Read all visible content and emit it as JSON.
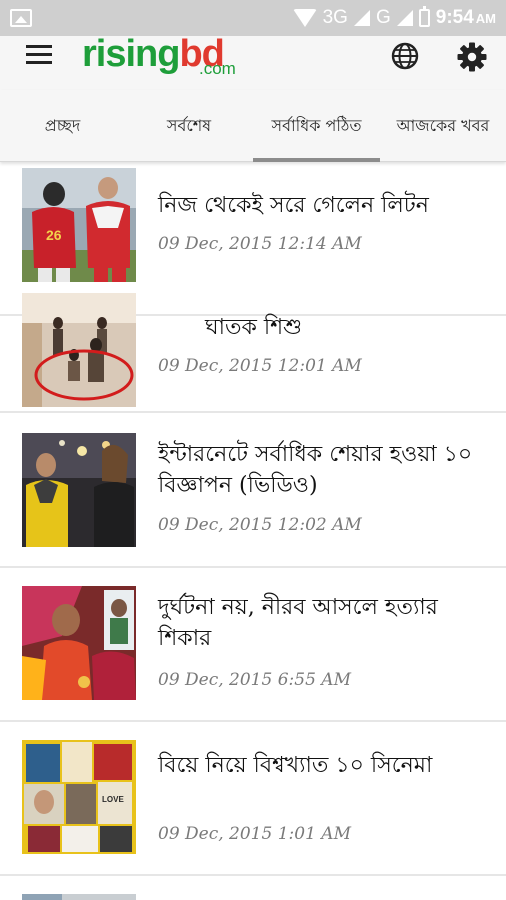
{
  "status_bar": {
    "network_3g": "3G",
    "network_g": "G",
    "time": "9:54",
    "ampm": "AM"
  },
  "app_bar": {
    "logo_text_main": "rising",
    "logo_text_bd": "bd",
    "logo_text_com": ".com",
    "brand_green": "#1e9e3a",
    "brand_red": "#e03a2f"
  },
  "tabs": [
    {
      "label": "প্রচ্ছদ"
    },
    {
      "label": "সর্বশেষ"
    },
    {
      "label": "সর্বাধিক পঠিত",
      "selected": true
    },
    {
      "label": "আজকের খবর"
    }
  ],
  "articles": [
    {
      "title": "নিজ থেকেই সরে গেলেন লিটন",
      "date": "09 Dec, 2015 12:14 AM",
      "thumb": "cricket-players"
    },
    {
      "title": "ঘাতক শিশু",
      "date": "09 Dec, 2015 12:01 AM",
      "thumb": "cctv-child-circled"
    },
    {
      "title": "ইন্টারনেটে সর্বাধিক শেয়ার হওয়া ১০ বিজ্ঞাপন (ভিডিও)",
      "date": "09 Dec, 2015 12:02 AM",
      "thumb": "street-crowd"
    },
    {
      "title": "দুর্ঘটনা নয়, নীরব আসলে হত্যার শিকার",
      "date": "09 Dec, 2015 6:55 AM",
      "thumb": "family-photo"
    },
    {
      "title": "বিয়ে নিয়ে বিশ্বখ্যাত ১০ সিনেমা",
      "date": "09 Dec, 2015 1:01 AM",
      "thumb": "movie-posters"
    }
  ]
}
